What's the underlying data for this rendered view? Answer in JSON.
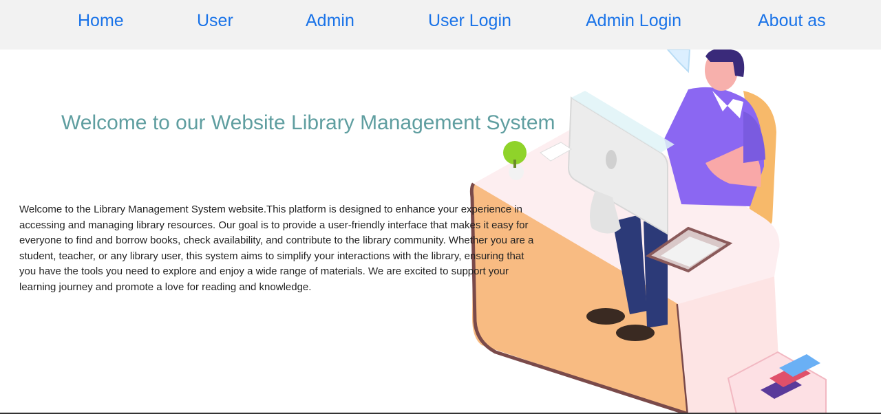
{
  "nav": {
    "items": [
      {
        "label": "Home"
      },
      {
        "label": "User"
      },
      {
        "label": "Admin"
      },
      {
        "label": "User Login"
      },
      {
        "label": "Admin Login"
      },
      {
        "label": "About as"
      }
    ]
  },
  "main": {
    "title": "Welcome to our Website Library Management System",
    "intro": "Welcome to the Library Management System website.This platform is designed to enhance your experience in accessing and managing library resources. Our goal is to provide a user-friendly interface that makes it easy for everyone to find and borrow books, check availability, and contribute to the library community. Whether you are a student, teacher, or any library user, this system aims to simplify your interactions with the library, ensuring that you have the tools you need to explore and enjoy a wide range of materials. We are excited to support your learning journey and promote a love for reading and knowledge."
  },
  "colors": {
    "nav_background": "#f2f2f2",
    "nav_link": "#1a73e8",
    "title": "#5f9ea0",
    "body_text": "#222222"
  },
  "illustration": {
    "icon": "man-at-desk-with-computer-illustration"
  }
}
